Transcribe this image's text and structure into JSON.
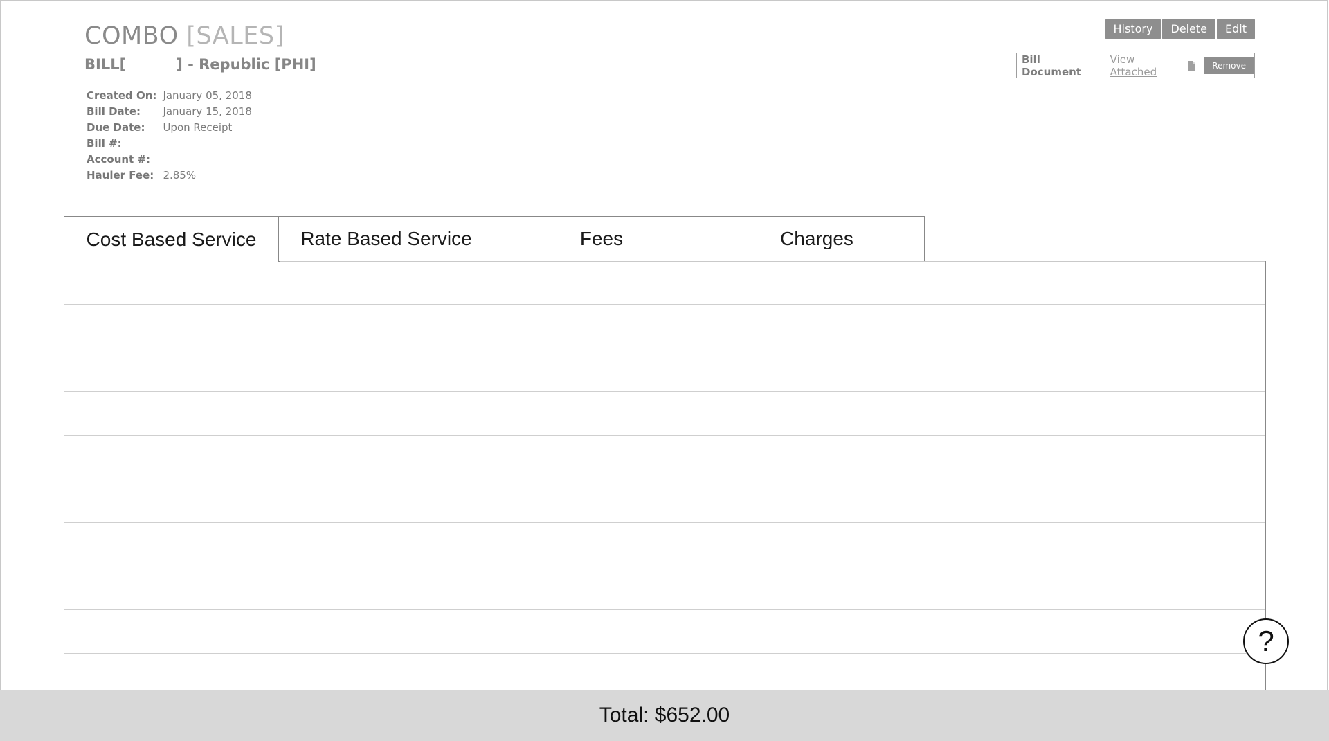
{
  "header": {
    "title": "COMBO",
    "title_suffix": "[SALES]",
    "bill_prefix": "BILL[",
    "bill_suffix": "] - Republic [PHI]"
  },
  "meta": [
    {
      "label": "Created On:",
      "value": "January 05, 2018"
    },
    {
      "label": "Bill Date:",
      "value": "January 15, 2018"
    },
    {
      "label": "Due Date:",
      "value": "Upon Receipt"
    },
    {
      "label": "Bill #:",
      "value": ""
    },
    {
      "label": "Account #:",
      "value": ""
    },
    {
      "label": "Hauler Fee:",
      "value": "2.85%"
    }
  ],
  "actions": {
    "history": "History",
    "delete": "Delete",
    "edit": "Edit"
  },
  "document": {
    "label": "Bill Document",
    "link": "View Attached",
    "icon": "document-icon",
    "remove": "Remove"
  },
  "tabs": [
    {
      "label": "Cost Based Service",
      "active": true
    },
    {
      "label": "Rate Based Service",
      "active": false
    },
    {
      "label": "Fees",
      "active": false
    },
    {
      "label": "Charges",
      "active": false
    }
  ],
  "footer": {
    "total": "Total: $652.00"
  },
  "help": {
    "label": "?",
    "icon": "help-icon"
  },
  "colors": {
    "button_bg": "#8e8e8e",
    "footer_bg": "#d8d8d8"
  }
}
